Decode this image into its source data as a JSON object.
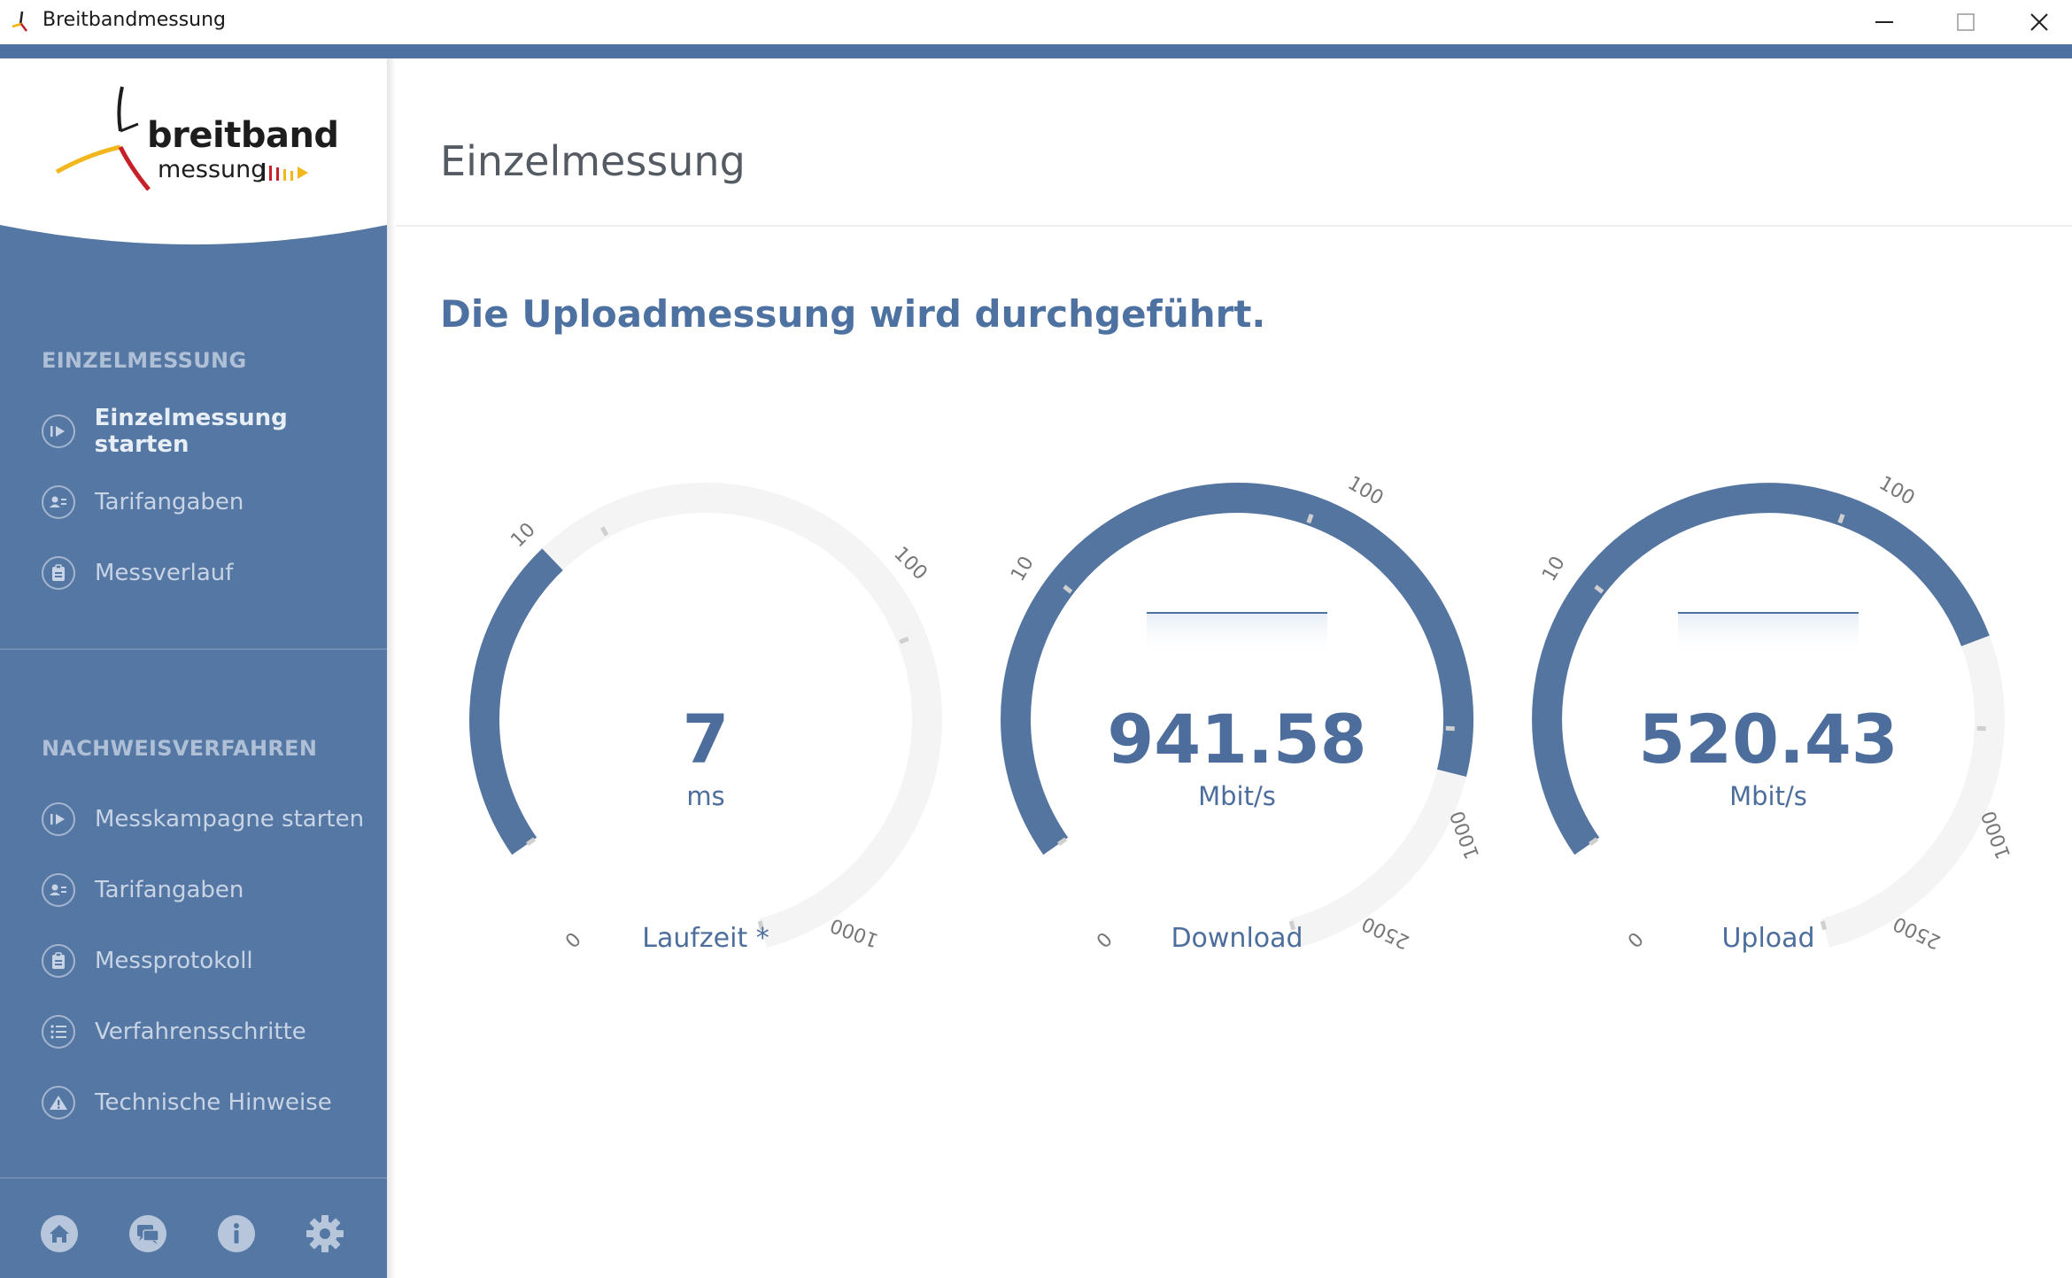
{
  "window": {
    "title": "Breitbandmessung"
  },
  "logo": {
    "line1": "breitband",
    "line2": "messung"
  },
  "sidebar": {
    "section1": {
      "title": "EINZELMESSUNG",
      "items": [
        {
          "label": "Einzelmessung starten",
          "icon": "play-icon"
        },
        {
          "label": "Tarifangaben",
          "icon": "user-card-icon"
        },
        {
          "label": "Messverlauf",
          "icon": "clipboard-icon"
        }
      ]
    },
    "section2": {
      "title": "NACHWEISVERFAHREN",
      "items": [
        {
          "label": "Messkampagne starten",
          "icon": "play-icon"
        },
        {
          "label": "Tarifangaben",
          "icon": "user-card-icon"
        },
        {
          "label": "Messprotokoll",
          "icon": "clipboard-icon"
        },
        {
          "label": "Verfahrensschritte",
          "icon": "list-icon"
        },
        {
          "label": "Technische Hinweise",
          "icon": "warning-icon"
        }
      ]
    },
    "bottom_icons": [
      "home-icon",
      "chat-icon",
      "info-icon",
      "settings-icon"
    ]
  },
  "main": {
    "title": "Einzelmessung",
    "status": "Die Uploadmessung wird durchgeführt."
  },
  "gauges": [
    {
      "id": "laufzeit",
      "value": "7",
      "unit": "ms",
      "label": "Laufzeit *",
      "ticks": [
        "0",
        "10",
        "100",
        "1000"
      ],
      "fill_fraction": 0.28
    },
    {
      "id": "download",
      "value": "941.58",
      "unit": "Mbit/s",
      "label": "Download",
      "ticks": [
        "0",
        "10",
        "100",
        "1000",
        "2500"
      ],
      "fill_fraction": 0.79
    },
    {
      "id": "upload",
      "value": "520.43",
      "unit": "Mbit/s",
      "label": "Upload",
      "ticks": [
        "0",
        "10",
        "100",
        "1000",
        "2500"
      ],
      "fill_fraction": 0.67
    }
  ],
  "colors": {
    "accent": "#4d71a0",
    "sidebar": "#5577a3",
    "gauge_track": "#f4f4f4",
    "gauge_fill": "#5575a1"
  }
}
